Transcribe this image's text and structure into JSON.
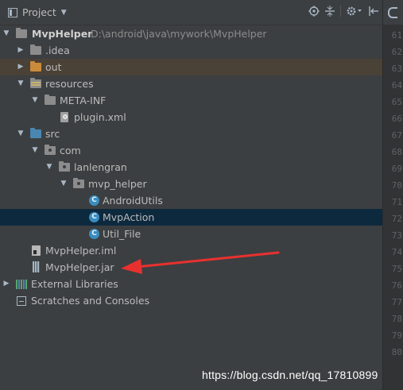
{
  "toolbar": {
    "title": "Project",
    "icons": [
      "project-view-icon",
      "chevron-down-icon",
      "locate-icon",
      "collapse-all-icon",
      "settings-icon",
      "hide-icon"
    ]
  },
  "tree": [
    {
      "label": "MvpHelper",
      "path": "D:\\android\\java\\mywork\\MvpHelper",
      "icon": "folder-icon",
      "expanded": true
    },
    {
      "label": ".idea",
      "icon": "folder-icon",
      "expanded": false
    },
    {
      "label": "out",
      "icon": "folder-icon",
      "expanded": false,
      "color": "#c98b3b"
    },
    {
      "label": "resources",
      "icon": "folder-icon",
      "expanded": true
    },
    {
      "label": "META-INF",
      "icon": "folder-icon",
      "expanded": true
    },
    {
      "label": "plugin.xml",
      "icon": "xml-file-icon"
    },
    {
      "label": "src",
      "icon": "folder-icon",
      "expanded": true
    },
    {
      "label": "com",
      "icon": "package-icon",
      "expanded": true
    },
    {
      "label": "lanlengran",
      "icon": "package-icon",
      "expanded": true
    },
    {
      "label": "mvp_helper",
      "icon": "package-icon",
      "expanded": true
    },
    {
      "label": "AndroidUtils",
      "icon": "class-icon",
      "icon_letter": "C"
    },
    {
      "label": "MvpAction",
      "icon": "class-icon",
      "icon_letter": "C",
      "selected": true
    },
    {
      "label": "Util_File",
      "icon": "class-icon",
      "icon_letter": "C"
    },
    {
      "label": "MvpHelper.iml",
      "icon": "iml-file-icon"
    },
    {
      "label": "MvpHelper.jar",
      "icon": "jar-file-icon"
    },
    {
      "label": "External Libraries",
      "icon": "libraries-icon",
      "expanded": false
    },
    {
      "label": "Scratches and Consoles",
      "icon": "scratches-icon"
    }
  ],
  "gutter": {
    "line_numbers": [
      "61",
      "62",
      "63",
      "64",
      "65",
      "66",
      "67",
      "68",
      "69",
      "70",
      "71",
      "72",
      "73",
      "74",
      "75",
      "76",
      "77",
      "78",
      "79",
      "80"
    ]
  },
  "annotation": {
    "arrow_color": "#e8312f",
    "target": "MvpHelper.jar"
  },
  "watermark": "https://blog.csdn.net/qq_17810899",
  "colors": {
    "panel_bg": "#3c3f41",
    "selection_bg": "#0d293e",
    "text": "#bbbbbb",
    "path_text": "#8c8c8c",
    "class_icon": "#3a8cbf",
    "source_folder": "#4a86b1",
    "excluded_folder": "#c98b3b"
  }
}
